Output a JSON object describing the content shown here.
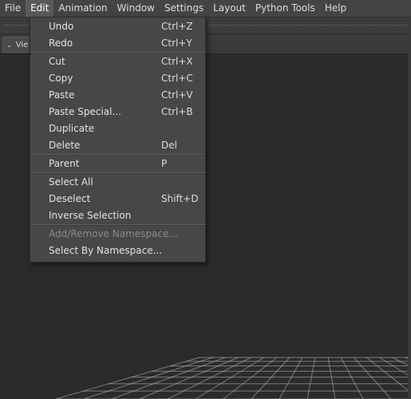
{
  "menubar": {
    "items": [
      {
        "label": "File"
      },
      {
        "label": "Edit"
      },
      {
        "label": "Animation"
      },
      {
        "label": "Window"
      },
      {
        "label": "Settings"
      },
      {
        "label": "Layout"
      },
      {
        "label": "Python Tools"
      },
      {
        "label": "Help"
      }
    ],
    "active": "Edit"
  },
  "viewport_toolbar": {
    "panel_menu_label": "Vie"
  },
  "edit_menu": {
    "groups": [
      [
        {
          "label": "Undo",
          "shortcut": "Ctrl+Z"
        },
        {
          "label": "Redo",
          "shortcut": "Ctrl+Y"
        }
      ],
      [
        {
          "label": "Cut",
          "shortcut": "Ctrl+X"
        },
        {
          "label": "Copy",
          "shortcut": "Ctrl+C"
        },
        {
          "label": "Paste",
          "shortcut": "Ctrl+V"
        },
        {
          "label": "Paste Special...",
          "shortcut": "Ctrl+B"
        },
        {
          "label": "Duplicate",
          "shortcut": ""
        },
        {
          "label": "Delete",
          "shortcut": "Del"
        }
      ],
      [
        {
          "label": "Parent",
          "shortcut": "P"
        }
      ],
      [
        {
          "label": "Select All",
          "shortcut": ""
        },
        {
          "label": "Deselect",
          "shortcut": "Shift+D"
        },
        {
          "label": "Inverse Selection",
          "shortcut": ""
        }
      ],
      [
        {
          "label": "Add/Remove Namespace...",
          "shortcut": "",
          "disabled": true
        },
        {
          "label": "Select By Namespace...",
          "shortcut": ""
        }
      ]
    ]
  },
  "colors": {
    "menubar_bg": "#444444",
    "menu_bg": "#474747",
    "viewport_bg": "#2b2b2b",
    "grid_line": "#bdbdbd"
  },
  "icons": {
    "panel_menu": "chevron-down-icon"
  }
}
